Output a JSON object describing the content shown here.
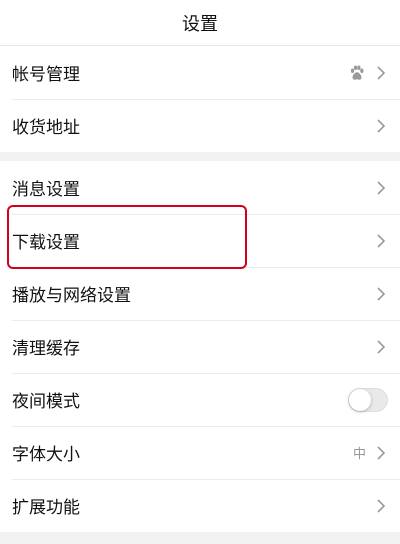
{
  "header": {
    "title": "设置"
  },
  "account_group": {
    "items": [
      {
        "label": "帐号管理",
        "icon": "paw-icon"
      },
      {
        "label": "收货地址"
      }
    ]
  },
  "settings_group": {
    "items": [
      {
        "label": "消息设置"
      },
      {
        "label": "下载设置"
      },
      {
        "label": "播放与网络设置"
      },
      {
        "label": "清理缓存"
      },
      {
        "label": "夜间模式",
        "toggle_on": false
      },
      {
        "label": "字体大小",
        "value": "中"
      },
      {
        "label": "扩展功能"
      }
    ]
  },
  "highlight_color": "#d0021b"
}
